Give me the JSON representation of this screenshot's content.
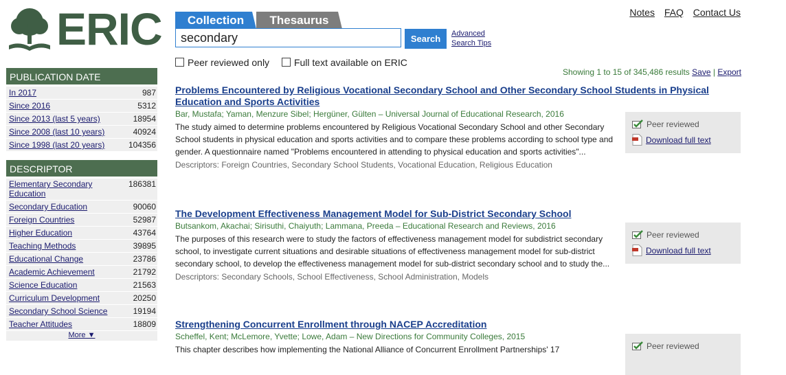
{
  "logo": {
    "text": "ERIC"
  },
  "search": {
    "tabs": [
      "Collection",
      "Thesaurus"
    ],
    "query": "secondary",
    "button": "Search",
    "advanced": "Advanced",
    "tips": "Search Tips",
    "filters": [
      "Peer reviewed only",
      "Full text available on ERIC"
    ]
  },
  "top_links": [
    "Notes",
    "FAQ",
    "Contact Us"
  ],
  "results_info": {
    "showing": "Showing 1 to 15 of 345,486 results",
    "save": "Save",
    "separator": "|",
    "export": "Export"
  },
  "sidebar": {
    "pub_date": {
      "heading": "PUBLICATION DATE",
      "items": [
        {
          "label": "In 2017",
          "count": "987"
        },
        {
          "label": "Since 2016",
          "count": "5312"
        },
        {
          "label": "Since 2013 (last 5 years)",
          "count": "18954"
        },
        {
          "label": "Since 2008 (last 10 years)",
          "count": "40924"
        },
        {
          "label": "Since 1998 (last 20 years)",
          "count": "104356"
        }
      ]
    },
    "descriptor": {
      "heading": "DESCRIPTOR",
      "items": [
        {
          "label": "Elementary Secondary Education",
          "count": "186381"
        },
        {
          "label": "Secondary Education",
          "count": "90060"
        },
        {
          "label": "Foreign Countries",
          "count": "52987"
        },
        {
          "label": "Higher Education",
          "count": "43764"
        },
        {
          "label": "Teaching Methods",
          "count": "39895"
        },
        {
          "label": "Educational Change",
          "count": "23786"
        },
        {
          "label": "Academic Achievement",
          "count": "21792"
        },
        {
          "label": "Science Education",
          "count": "21563"
        },
        {
          "label": "Curriculum Development",
          "count": "20250"
        },
        {
          "label": "Secondary School Science",
          "count": "19194"
        },
        {
          "label": "Teacher Attitudes",
          "count": "18809"
        }
      ],
      "more": "More ▼"
    }
  },
  "badges": {
    "peer": "Peer reviewed",
    "download": "Download full text"
  },
  "results": [
    {
      "title": "Problems Encountered by Religious Vocational Secondary School and Other Secondary School Students in Physical Education and Sports Activities",
      "meta": "Bar, Mustafa; Yaman, Menzure Sibel; Hergüner, Gülten – Universal Journal of Educational Research, 2016",
      "abstract": "The study aimed to determine problems encountered by Religious Vocational Secondary School and other Secondary School students in physical education and sports activities and to compare these problems according to school type and gender. A questionnaire named \"Problems encountered in attending to physical education and sports activities\"...",
      "descriptors": "Descriptors: Foreign Countries, Secondary School Students, Vocational Education, Religious Education"
    },
    {
      "title": "The Development Effectiveness Management Model for Sub-District Secondary School",
      "meta": "Butsankom, Akachai; Sirisuthi, Chaiyuth; Lammana, Preeda – Educational Research and Reviews, 2016",
      "abstract": "The purposes of this research were to study the factors of effectiveness management model for subdistrict secondary school, to investigate current situations and desirable situations of effectiveness management model for sub-district secondary school, to develop the effectiveness management model for sub-district secondary school and to study the...",
      "descriptors": "Descriptors: Secondary Schools, School Effectiveness, School Administration, Models"
    },
    {
      "title": "Strengthening Concurrent Enrollment through NACEP Accreditation",
      "meta": "Scheffel, Kent; McLemore, Yvette; Lowe, Adam – New Directions for Community Colleges, 2015",
      "abstract": "This chapter describes how implementing the National Alliance of Concurrent Enrollment Partnerships' 17",
      "descriptors": ""
    }
  ]
}
